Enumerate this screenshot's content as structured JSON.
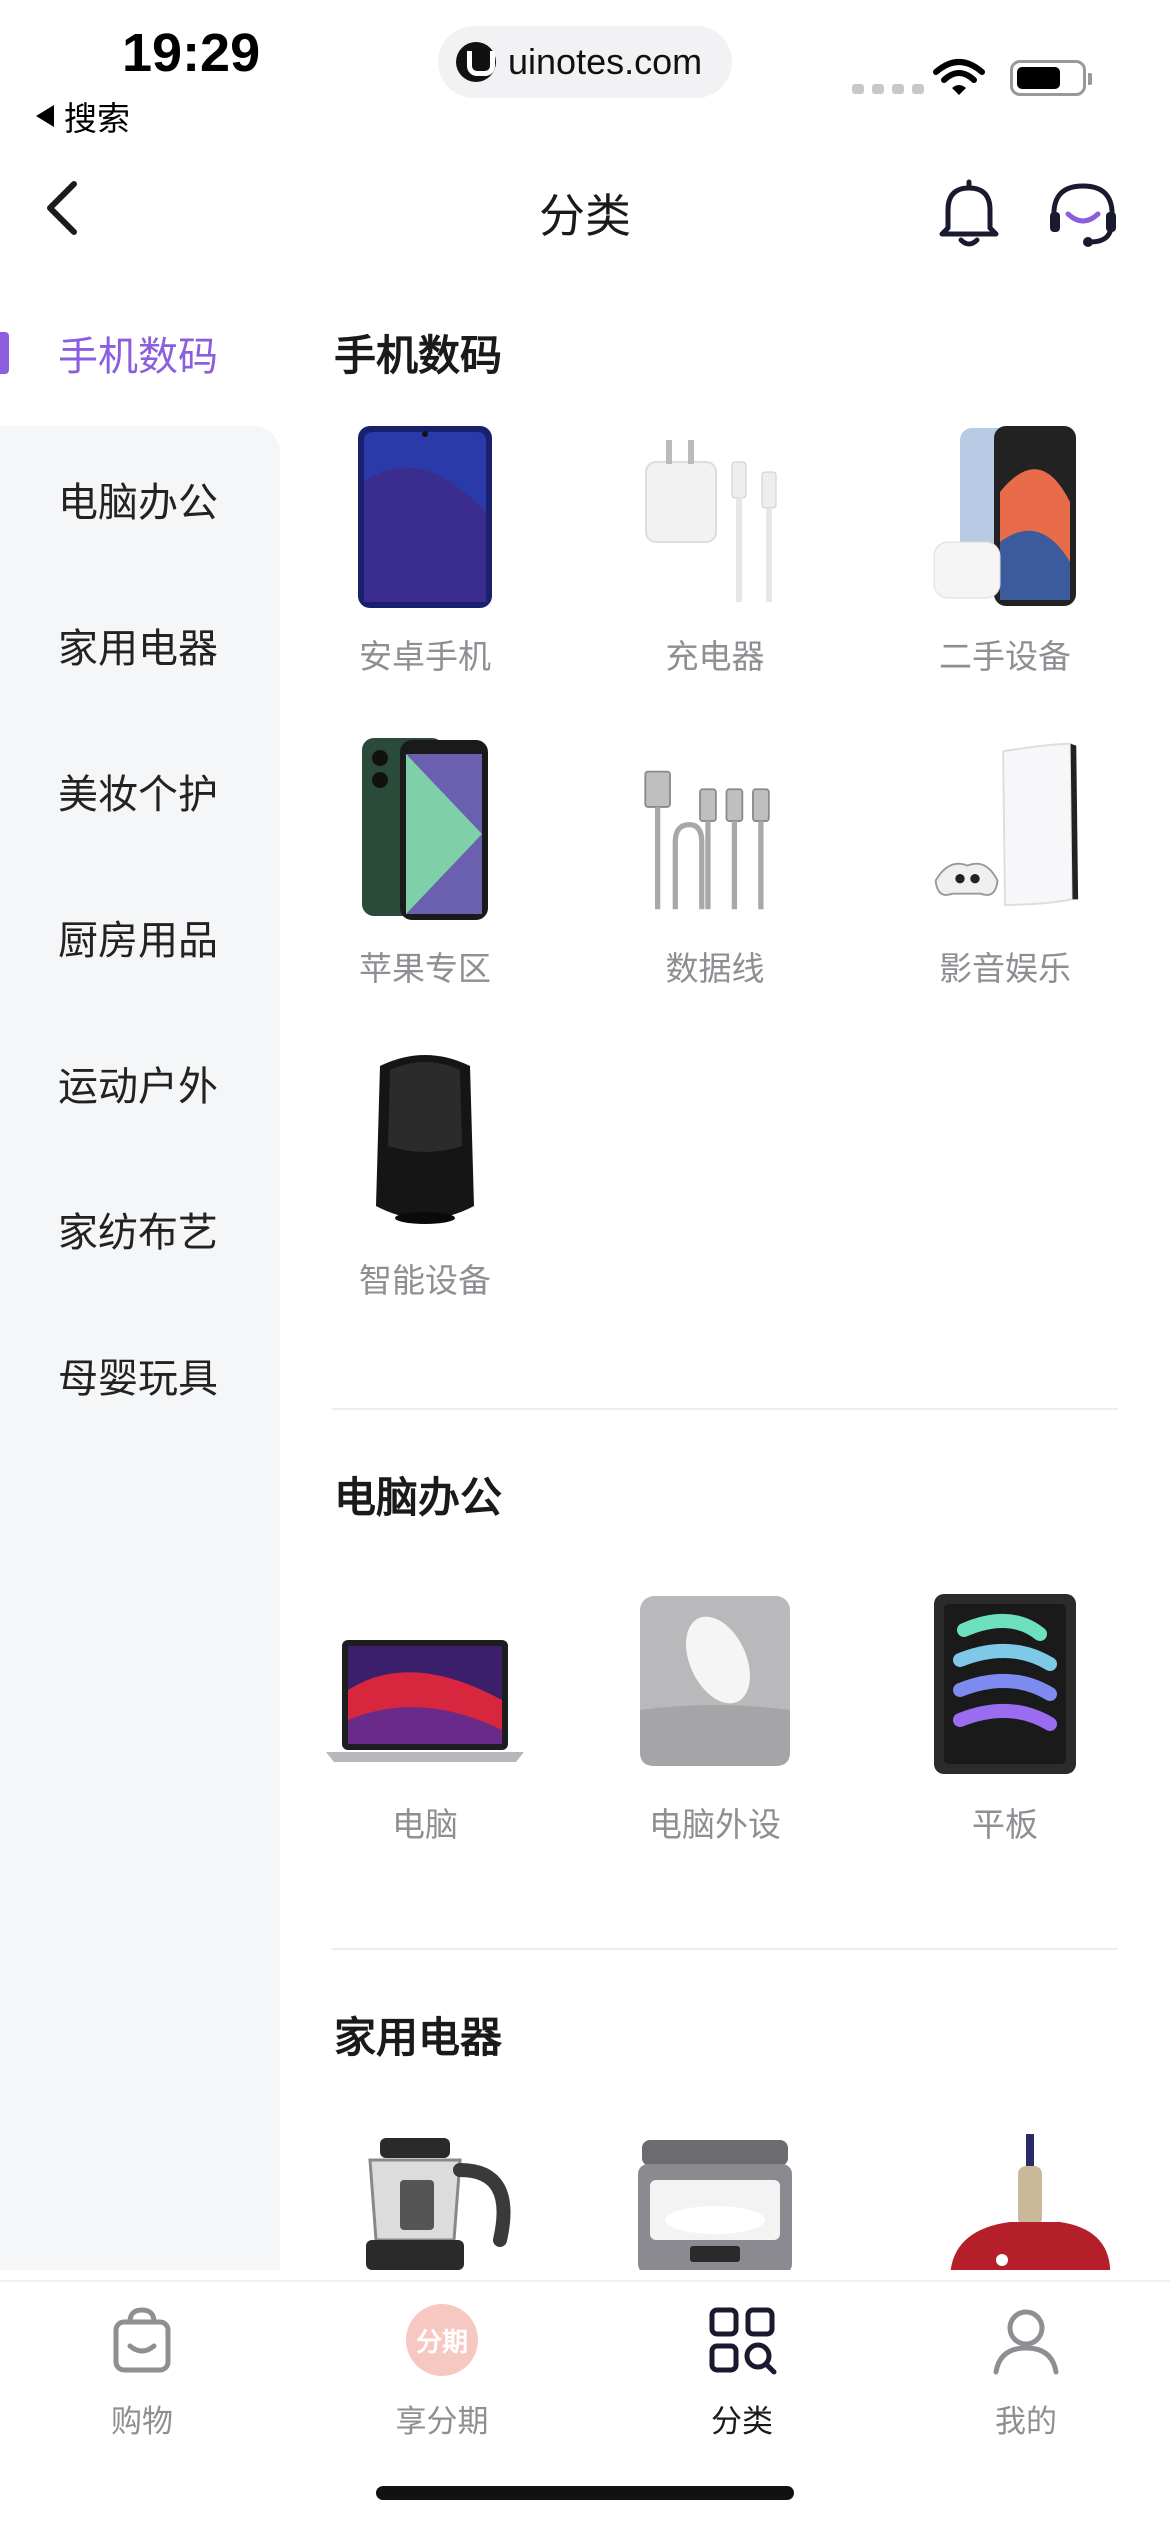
{
  "status_bar": {
    "time": "19:29",
    "back_label": "搜索",
    "url": "uinotes.com",
    "icons": [
      "signal-icon",
      "wifi-icon",
      "battery-icon"
    ]
  },
  "header": {
    "title": "分类",
    "icons": [
      "back-arrow-icon",
      "bell-icon",
      "customer-service-icon"
    ]
  },
  "sidebar": {
    "active_index": 0,
    "accent_color": "#8b5ee0",
    "items": [
      {
        "label": "手机数码"
      },
      {
        "label": "电脑办公"
      },
      {
        "label": "家用电器"
      },
      {
        "label": "美妆个护"
      },
      {
        "label": "厨房用品"
      },
      {
        "label": "运动户外"
      },
      {
        "label": "家纺布艺"
      },
      {
        "label": "母婴玩具"
      }
    ]
  },
  "sections": [
    {
      "title": "手机数码",
      "items": [
        {
          "label": "安卓手机",
          "icon": "android-phone-image"
        },
        {
          "label": "充电器",
          "icon": "charger-image"
        },
        {
          "label": "二手设备",
          "icon": "used-device-image"
        },
        {
          "label": "苹果专区",
          "icon": "iphone-image"
        },
        {
          "label": "数据线",
          "icon": "cable-image"
        },
        {
          "label": "影音娱乐",
          "icon": "game-console-image"
        },
        {
          "label": "智能设备",
          "icon": "smart-speaker-image"
        }
      ]
    },
    {
      "title": "电脑办公",
      "items": [
        {
          "label": "电脑",
          "icon": "laptop-image"
        },
        {
          "label": "电脑外设",
          "icon": "mouse-pad-image"
        },
        {
          "label": "平板",
          "icon": "tablet-image"
        }
      ]
    },
    {
      "title": "家用电器",
      "items": [
        {
          "label": "",
          "icon": "kettle-image"
        },
        {
          "label": "",
          "icon": "rice-cooker-image"
        },
        {
          "label": "",
          "icon": "vacuum-image"
        }
      ]
    }
  ],
  "tabbar": {
    "active_index": 2,
    "items": [
      {
        "label": "购物",
        "icon": "shopping-bag-icon"
      },
      {
        "label": "享分期",
        "icon": "installment-icon",
        "badge_text": "分期"
      },
      {
        "label": "分类",
        "icon": "category-grid-icon"
      },
      {
        "label": "我的",
        "icon": "profile-icon"
      }
    ]
  }
}
